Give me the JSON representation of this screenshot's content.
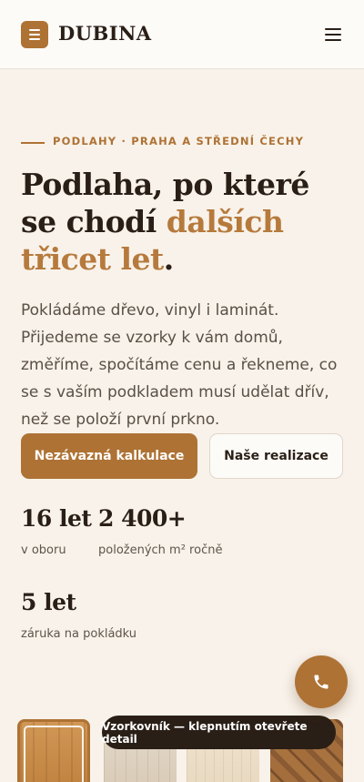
{
  "header": {
    "brand": "DUBINA",
    "logo_icon": "menu-lines-icon",
    "menu_icon": "hamburger-icon"
  },
  "hero": {
    "eyebrow": "PODLAHY · PRAHA A STŘEDNÍ ČECHY",
    "headline_part1": "Podlaha, po které se chodí ",
    "headline_accent": "dalších třicet let",
    "headline_end": ".",
    "lead": "Pokládáme dřevo, vinyl i laminát. Přijedeme se vzorky k vám domů, změříme, spočítáme cenu a řekneme, co se s vaším podkladem musí udělat dřív, než se položí první prkno.",
    "primary_button": "Nezávazná kalkulace",
    "secondary_button": "Naše realizace"
  },
  "stats": [
    {
      "value": "16 let",
      "label": "v oboru"
    },
    {
      "value": "2 400+",
      "label": "položených m² ročně"
    },
    {
      "value": "5 let",
      "label": "záruka na pokládku"
    }
  ],
  "fab": {
    "icon": "phone-icon"
  },
  "samples": {
    "tooltip": "Vzorkovník — klepnutím otevřete detail"
  },
  "colors": {
    "accent": "#ae7234",
    "background": "#f8f2ea",
    "text": "#2a1f17"
  }
}
